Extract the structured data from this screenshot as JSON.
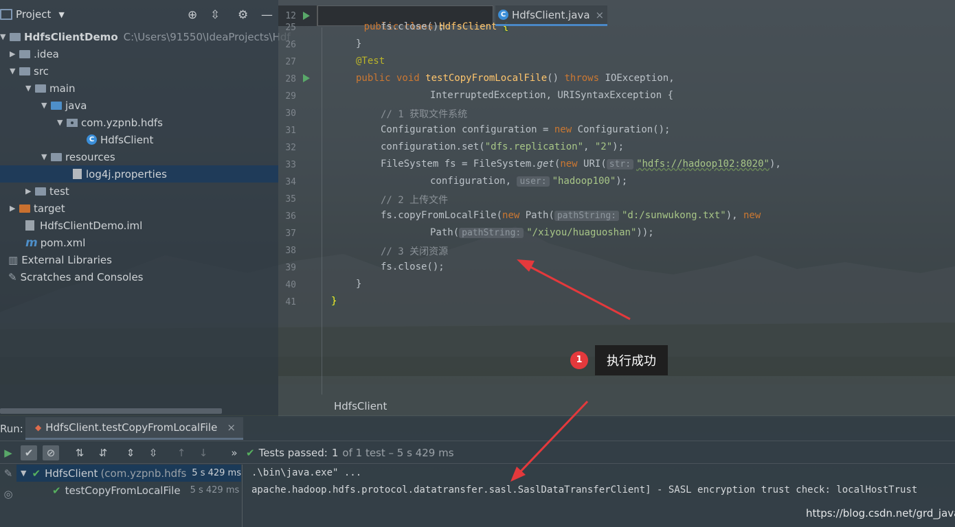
{
  "project_panel": {
    "title": "Project",
    "tree": [
      {
        "label": "HdfsClientDemo",
        "path": "C:\\Users\\91550\\IdeaProjects\\Hdf"
      },
      {
        "label": ".idea"
      },
      {
        "label": "src"
      },
      {
        "label": "main"
      },
      {
        "label": "java"
      },
      {
        "label": "com.yzpnb.hdfs"
      },
      {
        "label": "HdfsClient"
      },
      {
        "label": "resources"
      },
      {
        "label": "log4j.properties"
      },
      {
        "label": "test"
      },
      {
        "label": "target"
      },
      {
        "label": "HdfsClientDemo.iml"
      },
      {
        "label": "pom.xml"
      },
      {
        "label": "External Libraries"
      },
      {
        "label": "Scratches and Consoles"
      }
    ]
  },
  "editor": {
    "sticky_line_number": "12",
    "sticky_code": {
      "kw": "public class",
      "name": "HdfsClient",
      "brace": "{"
    },
    "tab_label": "HdfsClient.java",
    "tab_close": "×",
    "lines": [
      {
        "n": "25",
        "indent": "        ",
        "a": "fs.close();"
      },
      {
        "n": "26",
        "indent": "    ",
        "a": "}"
      },
      {
        "n": "27",
        "indent": "    ",
        "ann": "@Test"
      },
      {
        "n": "28"
      },
      {
        "n": "29",
        "indent": "            ",
        "a": "InterruptedException, URISyntaxException {"
      },
      {
        "n": "30",
        "indent": "        ",
        "cm": "// 1 获取文件系统"
      },
      {
        "n": "31"
      },
      {
        "n": "32"
      },
      {
        "n": "33"
      },
      {
        "n": "34"
      },
      {
        "n": "35",
        "indent": "        ",
        "cm": "// 2 上传文件"
      },
      {
        "n": "36"
      },
      {
        "n": "37"
      },
      {
        "n": "38",
        "indent": "        ",
        "cm": "// 3 关闭资源"
      },
      {
        "n": "39",
        "indent": "        ",
        "a": "fs.close();"
      },
      {
        "n": "40",
        "indent": "    ",
        "a": "}"
      },
      {
        "n": "41",
        "a": "}"
      }
    ],
    "l28": {
      "kw1": "public void",
      "fn": "testCopyFromLocalFile",
      "a": "() ",
      "kw2": "throws",
      "b": " IOException,"
    },
    "l31": {
      "a": "Configuration configuration = ",
      "kw": "new",
      "b": " Configuration();"
    },
    "l32": {
      "a": "configuration.set(",
      "s1": "\"dfs.replication\"",
      "b": ", ",
      "s2": "\"2\"",
      "c": ");"
    },
    "l33": {
      "a": "FileSystem fs = FileSystem.",
      "get": "get",
      "b": "(",
      "kw": "new",
      "c": " URI(",
      "hint": "str:",
      "s": "\"hdfs://hadoop102:8020\"",
      "d": "),"
    },
    "l34": {
      "a": "configuration, ",
      "hint": "user:",
      "s": "\"hadoop100\"",
      "b": ");"
    },
    "l36": {
      "a": "fs.copyFromLocalFile(",
      "kw": "new",
      "b": " Path(",
      "hint": "pathString:",
      "s": "\"d:/sunwukong.txt\"",
      "c": "), ",
      "kw2": "new"
    },
    "l37": {
      "a": "Path(",
      "hint": "pathString:",
      "s": "\"/xiyou/huaguoshan\"",
      "b": "));"
    },
    "breadcrumb": "HdfsClient"
  },
  "annotation": {
    "badge": "1",
    "text": "执行成功"
  },
  "run_panel": {
    "label": "Run:",
    "tab_label": "HdfsClient.testCopyFromLocalFile",
    "tab_close": "×",
    "status_prefix": "Tests passed:",
    "status_count": "1",
    "status_rest": "of 1 test – 5 s 429 ms",
    "tests": [
      {
        "name": "HdfsClient",
        "package": "(com.yzpnb.hdfs",
        "time": "5 s 429 ms"
      },
      {
        "name": "testCopyFromLocalFile",
        "time": "5 s 429 ms"
      }
    ],
    "console": [
      ".\\bin\\java.exe\" ...",
      "apache.hadoop.hdfs.protocol.datatransfer.sasl.SaslDataTransferClient] - SASL encryption trust check: localHostTrust"
    ]
  },
  "watermark": "https://blog.csdn.net/grd_java"
}
